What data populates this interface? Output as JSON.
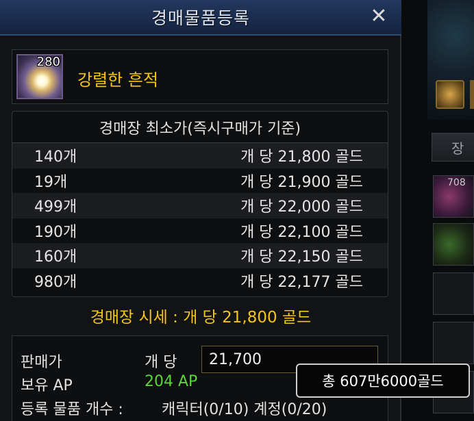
{
  "dialog": {
    "title": "경매물품등록",
    "close_glyph": "✕"
  },
  "item": {
    "icon": "glowing-trace-icon",
    "count": "280",
    "name": "강렬한 흔적"
  },
  "price_table": {
    "header": "경매장 최소가(즉시구매가 기준)",
    "rows": [
      {
        "qty": "140개",
        "unit_price": "개 당 21,800 골드"
      },
      {
        "qty": "19개",
        "unit_price": "개 당 21,900 골드"
      },
      {
        "qty": "499개",
        "unit_price": "개 당 22,000 골드"
      },
      {
        "qty": "190개",
        "unit_price": "개 당 22,100 골드"
      },
      {
        "qty": "160개",
        "unit_price": "개 당 22,150 골드"
      },
      {
        "qty": "980개",
        "unit_price": "개 당 22,177 골드"
      }
    ]
  },
  "market": {
    "text": "경매장 시세 : 개 당 21,800 골드"
  },
  "form": {
    "sell_price_label": "판매가",
    "per_unit_label": "개 당",
    "price_value": "21,700",
    "ap_label": "보유 AP",
    "ap_value": "204 AP",
    "register_label": "등록 물품 개수 :",
    "register_value": "캐릭터(0/10) 계정(0/20)"
  },
  "tooltip": {
    "total": "총 607만6000골드"
  },
  "background": {
    "tab_label": "장",
    "slot_count": "708"
  },
  "colors": {
    "gold": "#f4c419",
    "ap_green": "#5bd63a",
    "title_bar": "#1c2f52"
  }
}
